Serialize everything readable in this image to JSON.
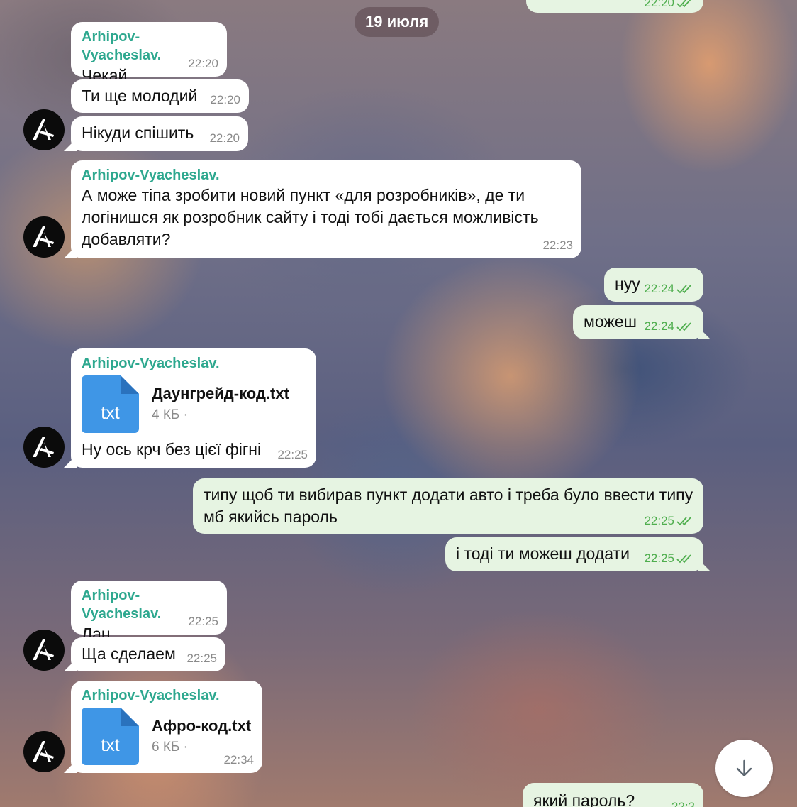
{
  "date_separator": "19 июля",
  "contact": {
    "name": "Arhipov-Vyacheslav.",
    "avatar_icon": "stylized-a-logo-icon"
  },
  "colors": {
    "sender_name": "#2ea88f",
    "outgoing_bubble": "#e6f4e2",
    "incoming_bubble": "#ffffff",
    "read_check": "#4fae4e",
    "file_icon": "#3f96e6"
  },
  "messages": [
    {
      "direction": "out",
      "text": "",
      "time": "22:20",
      "status": "read"
    },
    {
      "direction": "in",
      "sender": "Arhipov-Vyacheslav.",
      "text": "Чекай",
      "time": "22:20"
    },
    {
      "direction": "in",
      "text": "Ти ще молодий",
      "time": "22:20"
    },
    {
      "direction": "in",
      "text": "Нікуди спішить",
      "time": "22:20"
    },
    {
      "direction": "in",
      "sender": "Arhipov-Vyacheslav.",
      "text": "А може тіпа зробити новий пункт «для розробників», де ти логінишся як розробник сайту і тоді тобі дається можливість добавляти?",
      "time": "22:23"
    },
    {
      "direction": "out",
      "text": "нуу",
      "time": "22:24",
      "status": "read"
    },
    {
      "direction": "out",
      "text": "можеш",
      "time": "22:24",
      "status": "read"
    },
    {
      "direction": "in",
      "sender": "Arhipov-Vyacheslav.",
      "file": {
        "ext": "txt",
        "name": "Даунгрейд-код.txt",
        "size": "4 КБ ·"
      },
      "text": "Ну ось крч без цієї фігні",
      "time": "22:25"
    },
    {
      "direction": "out",
      "text": "типу щоб ти вибирав пункт додати авто і треба було ввести типу мб якийсь пароль",
      "time": "22:25",
      "status": "read"
    },
    {
      "direction": "out",
      "text": "і тоді ти можеш додати",
      "time": "22:25",
      "status": "read"
    },
    {
      "direction": "in",
      "sender": "Arhipov-Vyacheslav.",
      "text": "Лан",
      "time": "22:25"
    },
    {
      "direction": "in",
      "text": "Ща сделаем",
      "time": "22:25"
    },
    {
      "direction": "in",
      "sender": "Arhipov-Vyacheslav.",
      "file": {
        "ext": "txt",
        "name": "Афро-код.txt",
        "size": "6 КБ ·"
      },
      "time": "22:34"
    },
    {
      "direction": "out",
      "text": "який пароль?",
      "time": "22:3",
      "status": "read"
    }
  ],
  "scroll_down": {
    "icon": "arrow-down-icon"
  }
}
